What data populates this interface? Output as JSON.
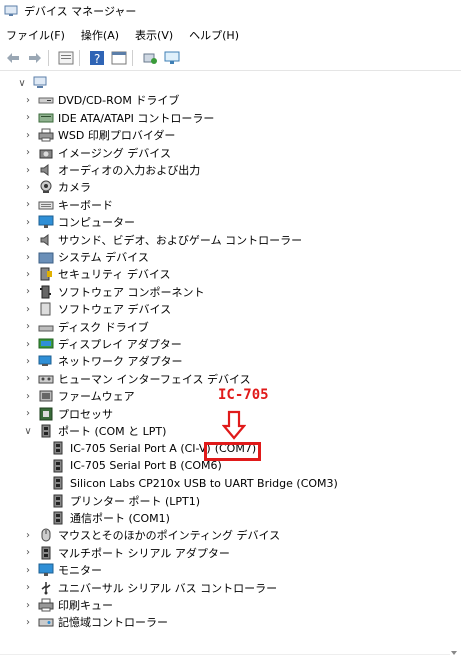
{
  "window": {
    "title": "デバイス マネージャー"
  },
  "menu": [
    {
      "label": "ファイル(F)"
    },
    {
      "label": "操作(A)"
    },
    {
      "label": "表示(V)"
    },
    {
      "label": "ヘルプ(H)"
    }
  ],
  "tree": [
    {
      "label": "",
      "level": 0,
      "expanded": true,
      "icon": "computer-icon"
    },
    {
      "label": "DVD/CD-ROM ドライブ",
      "level": 1,
      "icon": "dvd-drive-icon"
    },
    {
      "label": "IDE ATA/ATAPI コントローラー",
      "level": 1,
      "icon": "ide-controller-icon"
    },
    {
      "label": "WSD 印刷プロバイダー",
      "level": 1,
      "icon": "printer-icon"
    },
    {
      "label": "イメージング デバイス",
      "level": 1,
      "icon": "camera-device-icon"
    },
    {
      "label": "オーディオの入力および出力",
      "level": 1,
      "icon": "speaker-icon"
    },
    {
      "label": "カメラ",
      "level": 1,
      "icon": "webcam-icon"
    },
    {
      "label": "キーボード",
      "level": 1,
      "icon": "keyboard-icon"
    },
    {
      "label": "コンピューター",
      "level": 1,
      "icon": "monitor-icon"
    },
    {
      "label": "サウンド、ビデオ、およびゲーム コントローラー",
      "level": 1,
      "icon": "speaker-icon"
    },
    {
      "label": "システム デバイス",
      "level": 1,
      "icon": "folder-icon"
    },
    {
      "label": "セキュリティ デバイス",
      "level": 1,
      "icon": "security-icon"
    },
    {
      "label": "ソフトウェア コンポーネント",
      "level": 1,
      "icon": "component-icon"
    },
    {
      "label": "ソフトウェア デバイス",
      "level": 1,
      "icon": "device-icon"
    },
    {
      "label": "ディスク ドライブ",
      "level": 1,
      "icon": "disk-drive-icon"
    },
    {
      "label": "ディスプレイ アダプター",
      "level": 1,
      "icon": "display-adapter-icon"
    },
    {
      "label": "ネットワーク アダプター",
      "level": 1,
      "icon": "network-icon"
    },
    {
      "label": "ヒューマン インターフェイス デバイス",
      "level": 1,
      "icon": "hid-icon"
    },
    {
      "label": "ファームウェア",
      "level": 1,
      "icon": "firmware-icon"
    },
    {
      "label": "プロセッサ",
      "level": 1,
      "icon": "processor-icon"
    },
    {
      "label": "ポート (COM と LPT)",
      "level": 1,
      "expanded": true,
      "icon": "port-icon"
    },
    {
      "label": "IC-705 Serial Port A (CI-V)",
      "level": 2,
      "icon": "port-icon"
    },
    {
      "label": "IC-705 Serial Port B (COM6)",
      "level": 2,
      "icon": "port-icon"
    },
    {
      "label": "Silicon Labs CP210x USB to UART Bridge (COM3)",
      "level": 2,
      "icon": "port-icon"
    },
    {
      "label": "プリンター ポート (LPT1)",
      "level": 2,
      "icon": "port-icon"
    },
    {
      "label": "通信ポート (COM1)",
      "level": 2,
      "icon": "port-icon"
    },
    {
      "label": "マウスとそのほかのポインティング デバイス",
      "level": 1,
      "icon": "mouse-icon"
    },
    {
      "label": "マルチポート シリアル アダプター",
      "level": 1,
      "icon": "port-icon"
    },
    {
      "label": "モニター",
      "level": 1,
      "icon": "monitor-icon"
    },
    {
      "label": "ユニバーサル シリアル バス コントローラー",
      "level": 1,
      "icon": "usb-icon"
    },
    {
      "label": "印刷キュー",
      "level": 1,
      "icon": "printer-icon"
    },
    {
      "label": "記憶域コントローラー",
      "level": 1,
      "icon": "storage-controller-icon"
    }
  ],
  "annotation": {
    "title": "IC-705",
    "boxed_text": "(COM7)",
    "color": "#e01a1a"
  }
}
